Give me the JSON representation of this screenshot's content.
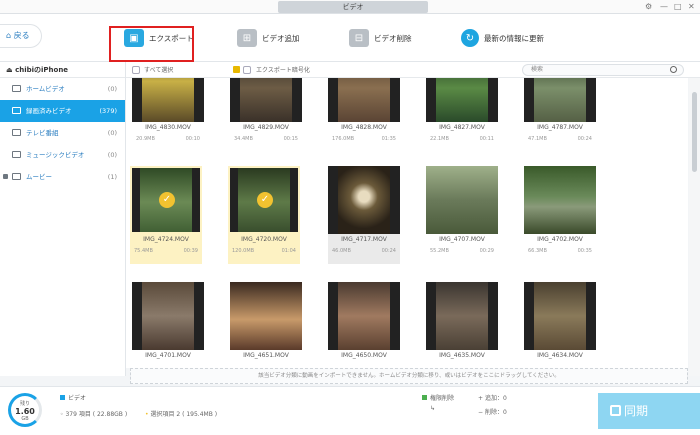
{
  "window": {
    "tab_title": "ビデオ",
    "gear": "⚙",
    "min": "—",
    "max": "□",
    "close": "✕"
  },
  "toolbar": {
    "back_label": "戻る",
    "export_label": "エクスポート",
    "add_label": "ビデオ追加",
    "delete_label": "ビデオ削除",
    "refresh_label": "最新の情報に更新"
  },
  "sidebar": {
    "device": "chibiのiPhone",
    "items": [
      {
        "label": "ホームビデオ",
        "count": "(0)"
      },
      {
        "label": "録画済みビデオ",
        "count": "(379)"
      },
      {
        "label": "テレビ番組",
        "count": "(0)"
      },
      {
        "label": "ミュージックビデオ",
        "count": "(0)"
      },
      {
        "label": "ムービー",
        "count": "(1)"
      }
    ]
  },
  "filter": {
    "select_all": "すべて選択",
    "encrypt": "エクスポート暗号化",
    "search_placeholder": "検索"
  },
  "videos": [
    {
      "name": "IMG_4830.MOV",
      "size": "20.9MB",
      "dur": "00:10"
    },
    {
      "name": "IMG_4829.MOV",
      "size": "34.4MB",
      "dur": "00:15"
    },
    {
      "name": "IMG_4828.MOV",
      "size": "176.0MB",
      "dur": "01:35"
    },
    {
      "name": "IMG_4827.MOV",
      "size": "22.1MB",
      "dur": "00:11"
    },
    {
      "name": "IMG_4787.MOV",
      "size": "47.1MB",
      "dur": "00:24"
    },
    {
      "name": "IMG_4724.MOV",
      "size": "75.4MB",
      "dur": "00:39"
    },
    {
      "name": "IMG_4720.MOV",
      "size": "120.0MB",
      "dur": "01:04"
    },
    {
      "name": "IMG_4717.MOV",
      "size": "46.0MB",
      "dur": "00:24"
    },
    {
      "name": "IMG_4707.MOV",
      "size": "55.2MB",
      "dur": "00:29"
    },
    {
      "name": "IMG_4702.MOV",
      "size": "66.3MB",
      "dur": "00:35"
    },
    {
      "name": "IMG_4701.MOV",
      "size": "",
      "dur": ""
    },
    {
      "name": "IMG_4651.MOV",
      "size": "",
      "dur": ""
    },
    {
      "name": "IMG_4650.MOV",
      "size": "",
      "dur": ""
    },
    {
      "name": "IMG_4635.MOV",
      "size": "",
      "dur": ""
    },
    {
      "name": "IMG_4634.MOV",
      "size": "",
      "dur": ""
    }
  ],
  "check_mark": "✓",
  "dropzone_text": "該当ビデオ分類に動画をインポートできません。ホームビデオ分類に移り、或いはビデオをここにドラッグしてください。",
  "status": {
    "gauge_top": "残り",
    "gauge_value": "1.60",
    "gauge_unit": "GB",
    "category": "ビデオ",
    "total": "379 項目 ( 22.88GB )",
    "selected": "選択項目 2 ( 195.4MB )",
    "perm_label": "権限削除",
    "add_label": "追加：",
    "add_count": "0",
    "delete_label": "削除：",
    "delete_count": "0",
    "sync_label": "同期"
  },
  "colors": {
    "accent": "#1aa2e6",
    "highlight_box": "#e02020",
    "selected_bg": "#fdf2c3",
    "check": "#f2c230"
  }
}
